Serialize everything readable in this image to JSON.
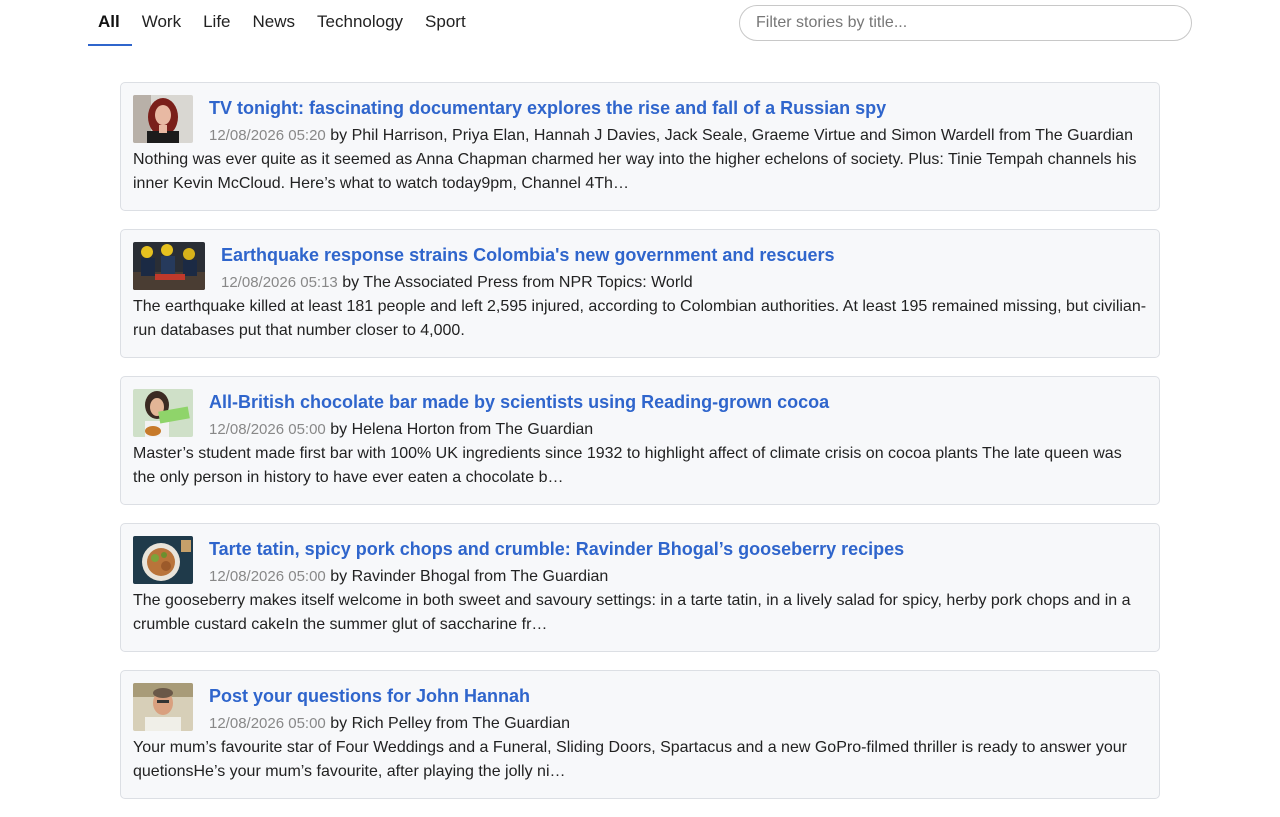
{
  "tabs": [
    {
      "label": "All",
      "active": true
    },
    {
      "label": "Work",
      "active": false
    },
    {
      "label": "Life",
      "active": false
    },
    {
      "label": "News",
      "active": false
    },
    {
      "label": "Technology",
      "active": false
    },
    {
      "label": "Sport",
      "active": false
    }
  ],
  "search": {
    "placeholder": "Filter stories by title...",
    "value": ""
  },
  "stories": [
    {
      "title": "TV tonight: fascinating documentary explores the rise and fall of a Russian spy",
      "date": "12/08/2026 05:20",
      "byline": "by Phil Harrison, Priya Elan, Hannah J Davies, Jack Seale, Graeme Virtue and Simon Wardell from The Guardian",
      "excerpt": "Nothing was ever quite as it seemed as Anna Chapman charmed her way into the higher echelons of society. Plus: Tinie Tempah channels his inner Kevin McCloud. Here’s what to watch today9pm, Channel 4Th…"
    },
    {
      "title": "Earthquake response strains Colombia's new government and rescuers",
      "date": "12/08/2026 05:13",
      "byline": "by The Associated Press from NPR Topics: World",
      "excerpt": "The earthquake killed at least 181 people and left 2,595 injured, according to Colombian authorities. At least 195 remained missing, but civilian-run databases put that number closer to 4,000."
    },
    {
      "title": "All-British chocolate bar made by scientists using Reading-grown cocoa",
      "date": "12/08/2026 05:00",
      "byline": "by Helena Horton from The Guardian",
      "excerpt": "Master’s student made first bar with 100% UK ingredients since 1932 to highlight affect of climate crisis on cocoa plants The late queen was the only person in history to have ever eaten a chocolate b…"
    },
    {
      "title": "Tarte tatin, spicy pork chops and crumble: Ravinder Bhogal’s gooseberry recipes",
      "date": "12/08/2026 05:00",
      "byline": "by Ravinder Bhogal from The Guardian",
      "excerpt": "The gooseberry makes itself welcome in both sweet and savoury settings: in a tarte tatin, in a lively salad for spicy, herby pork chops and in a crumble custard cakeIn the summer glut of saccharine fr…"
    },
    {
      "title": "Post your questions for John Hannah",
      "date": "12/08/2026 05:00",
      "byline": "by Rich Pelley from The Guardian",
      "excerpt": "Your mum’s favourite star of Four Weddings and a Funeral, Sliding Doors, Spartacus and a new GoPro-filmed thriller is ready to answer your quetionsHe’s your mum’s favourite, after playing the jolly ni…"
    }
  ],
  "colors": {
    "accent": "#2f65cc",
    "card_bg": "#f7f8fa",
    "card_border": "#dcdfe4",
    "date": "#888888"
  }
}
